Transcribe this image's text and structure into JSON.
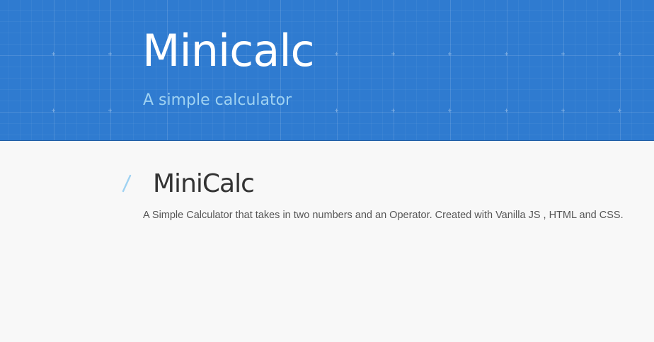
{
  "header": {
    "title": "Minicalc",
    "subtitle": "A simple calculator"
  },
  "project": {
    "title": "MiniCalc",
    "description": "A Simple Calculator that takes in two numbers and an Operator. Created with Vanilla JS , HTML and CSS."
  },
  "colors": {
    "header_background": "#2f7bd0",
    "title_text": "#ffffff",
    "subtitle_text": "#9fd2f2",
    "slash_accent": "#9fd2f2",
    "page_background": "#f8f8f8"
  },
  "icons": {
    "section_marker": "slash-icon"
  }
}
